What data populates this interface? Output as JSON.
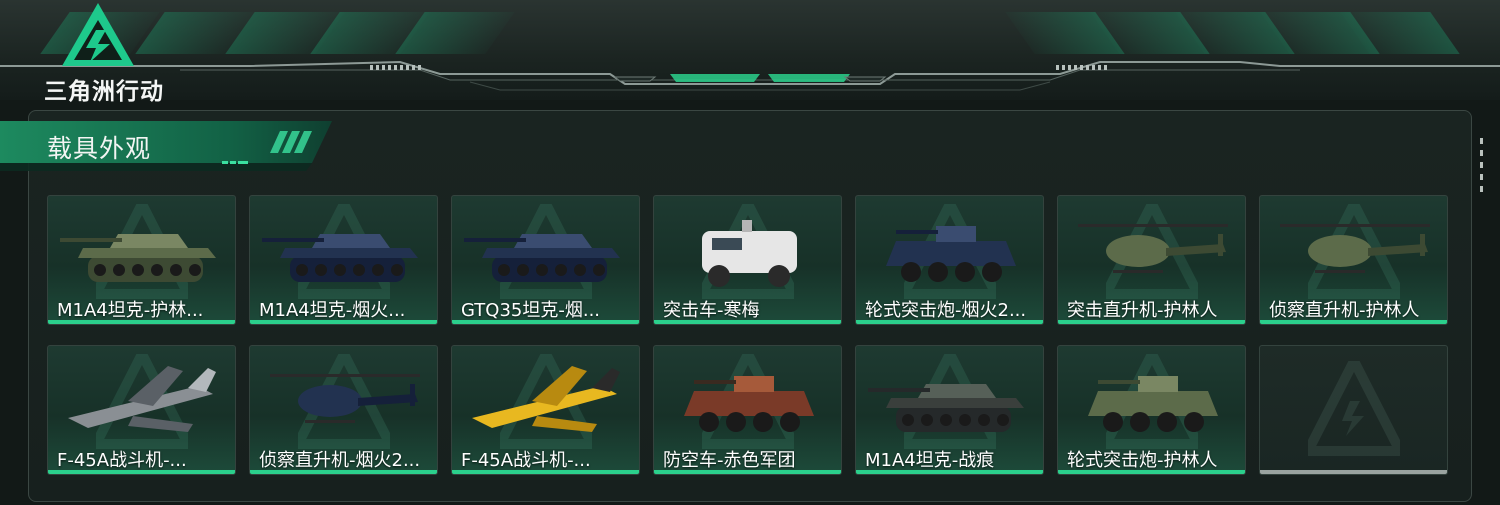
{
  "brand": {
    "name": "三角洲行动",
    "logo_icon": "delta-triangle-logo"
  },
  "section": {
    "title": "载具外观"
  },
  "colors": {
    "accent": "#2bd08c",
    "panel": "#17201e",
    "empty_bar": "#9aa3a0"
  },
  "vehicles": [
    {
      "label": "M1A4坦克-护林...",
      "kind": "tank",
      "pattern": "camo-green"
    },
    {
      "label": "M1A4坦克-烟火...",
      "kind": "tank",
      "pattern": "navy"
    },
    {
      "label": "GTQ35坦克-烟...",
      "kind": "tank",
      "pattern": "navy"
    },
    {
      "label": "突击车-寒梅",
      "kind": "truck",
      "pattern": "white"
    },
    {
      "label": "轮式突击炮-烟火2...",
      "kind": "apc",
      "pattern": "navy"
    },
    {
      "label": "突击直升机-护林人",
      "kind": "helicopter",
      "pattern": "camo-green"
    },
    {
      "label": "侦察直升机-护林人",
      "kind": "helicopter",
      "pattern": "camo-green"
    },
    {
      "label": "F-45A战斗机-...",
      "kind": "jet",
      "pattern": "grey-camo"
    },
    {
      "label": "侦察直升机-烟火2...",
      "kind": "helicopter",
      "pattern": "navy"
    },
    {
      "label": "F-45A战斗机-...",
      "kind": "jet",
      "pattern": "yellow"
    },
    {
      "label": "防空车-赤色军团",
      "kind": "apc",
      "pattern": "red-camo"
    },
    {
      "label": "M1A4坦克-战痕",
      "kind": "tank",
      "pattern": "dark"
    },
    {
      "label": "轮式突击炮-护林人",
      "kind": "apc",
      "pattern": "camo-green"
    },
    {
      "label": "",
      "kind": "empty",
      "pattern": "none"
    }
  ]
}
